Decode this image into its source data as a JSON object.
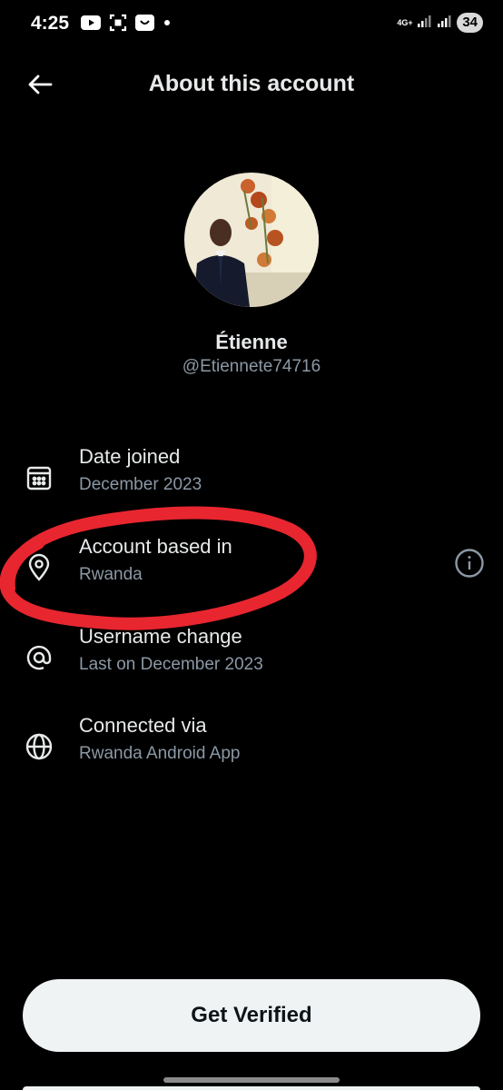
{
  "status_bar": {
    "time": "4:25",
    "network_type": "4G+",
    "battery_level": "34",
    "icons": [
      "youtube-icon",
      "scan-icon",
      "shop-icon",
      "dot-icon",
      "wifi-signal-icon",
      "cell-signal-icon"
    ]
  },
  "header": {
    "title": "About this account",
    "back_icon": "arrow-left-icon"
  },
  "profile": {
    "display_name": "Étienne",
    "handle": "@Etiennete74716"
  },
  "rows": [
    {
      "label": "Date joined",
      "value": "December 2023",
      "icon": "calendar-icon"
    },
    {
      "label": "Account based in",
      "value": "Rwanda",
      "icon": "location-pin-icon",
      "has_info": true
    },
    {
      "label": "Username change",
      "value": "Last on December 2023",
      "icon": "at-sign-icon"
    },
    {
      "label": "Connected via",
      "value": "Rwanda Android App",
      "icon": "globe-icon"
    }
  ],
  "cta": {
    "label": "Get Verified"
  },
  "colors": {
    "background": "#000000",
    "primary_text": "#e7e9ea",
    "secondary_text": "#8b98a5",
    "button_bg": "#eff3f4",
    "annotation": "#e8262f"
  }
}
